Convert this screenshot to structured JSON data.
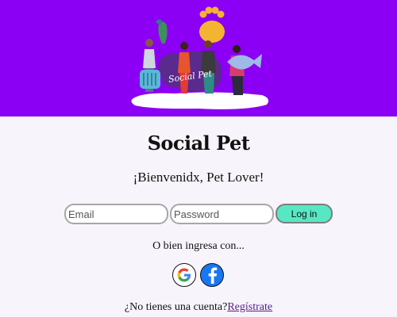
{
  "header": {
    "hero_text": "Social Pet",
    "colors": {
      "background": "#8b00f4"
    }
  },
  "title": "Social Pet",
  "welcome": "¡Bienvenidx, Pet Lover!",
  "form": {
    "email_placeholder": "Email",
    "password_placeholder": "Password",
    "login_label": "Log in",
    "colors": {
      "login_button": "#56e8c4"
    }
  },
  "alternative": {
    "text": "O bien ingresa con...",
    "providers": [
      "google-icon",
      "facebook-icon"
    ]
  },
  "register": {
    "question": "¿No tienes una cuenta?",
    "link": "Regístrate"
  }
}
